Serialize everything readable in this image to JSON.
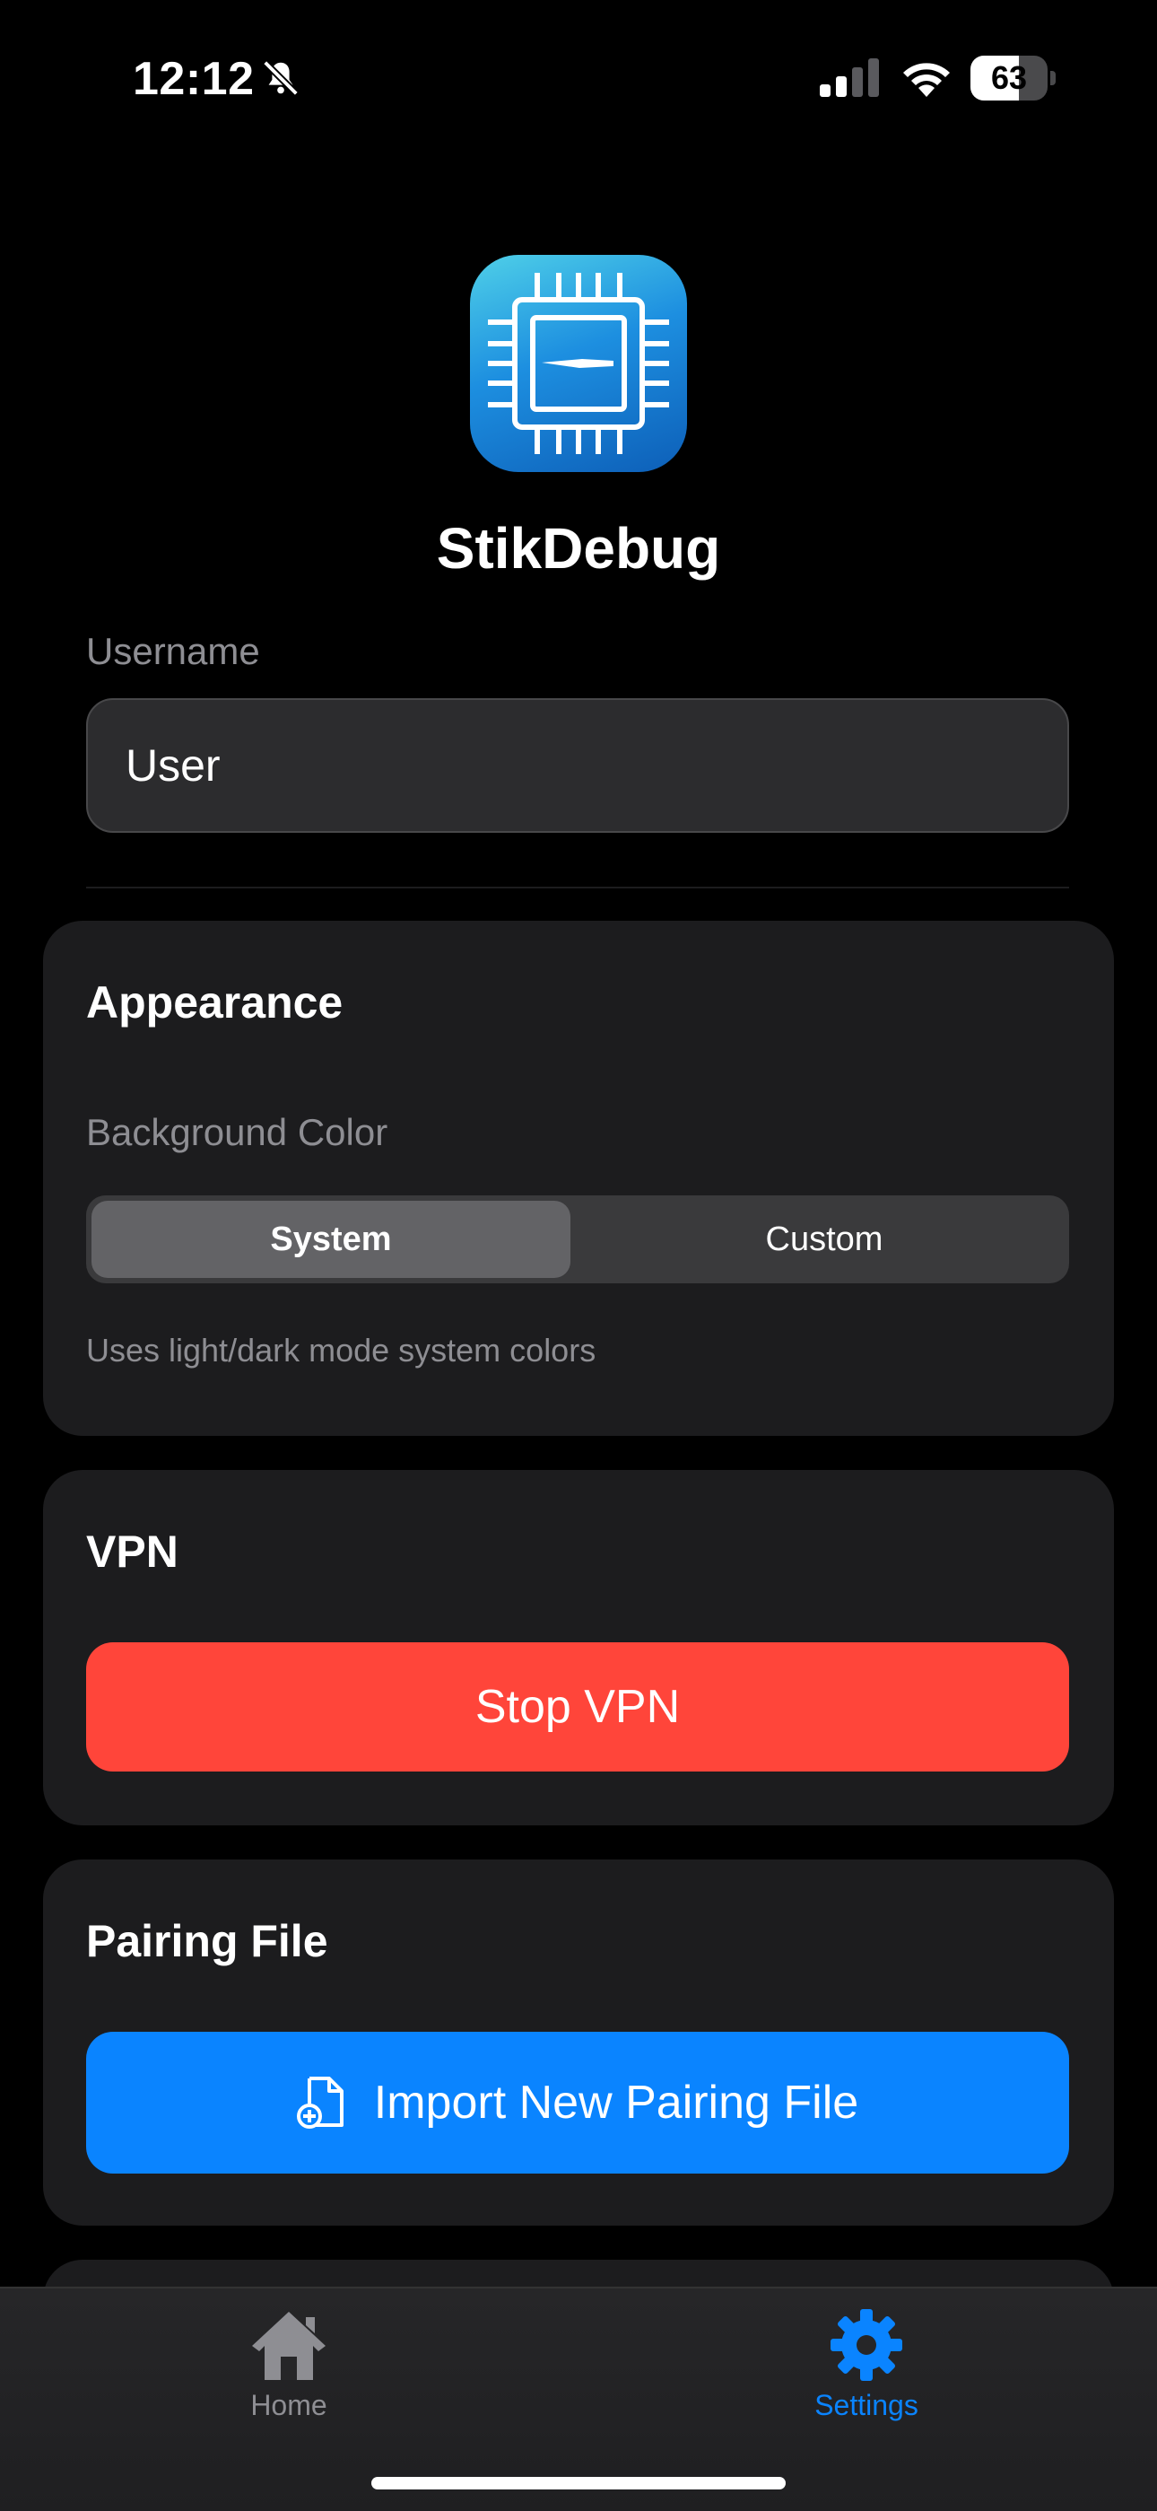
{
  "status_bar": {
    "time": "12:12",
    "battery_level": "63",
    "battery_fraction": 0.63,
    "icons": [
      "bell-slash-icon",
      "cellular-signal-icon",
      "wifi-icon",
      "battery-icon"
    ]
  },
  "header": {
    "app_name": "StikDebug",
    "app_icon": "cpu-chip-icon"
  },
  "username": {
    "label": "Username",
    "value": "User"
  },
  "appearance": {
    "title": "Appearance",
    "background_color_label": "Background Color",
    "options": [
      "System",
      "Custom"
    ],
    "selected_option": "System",
    "hint": "Uses light/dark mode system colors"
  },
  "vpn": {
    "title": "VPN",
    "button_label": "Stop VPN",
    "button_color": "#ff453a"
  },
  "pairing": {
    "title": "Pairing File",
    "button_label": "Import New Pairing File",
    "button_icon": "document-badge-plus-icon",
    "button_color": "#0a84ff"
  },
  "tab_bar": {
    "tabs": [
      {
        "label": "Home",
        "icon": "house-icon",
        "selected": false
      },
      {
        "label": "Settings",
        "icon": "gear-icon",
        "selected": true
      }
    ],
    "accent_color": "#0a84ff",
    "inactive_color": "#8e8e93"
  }
}
